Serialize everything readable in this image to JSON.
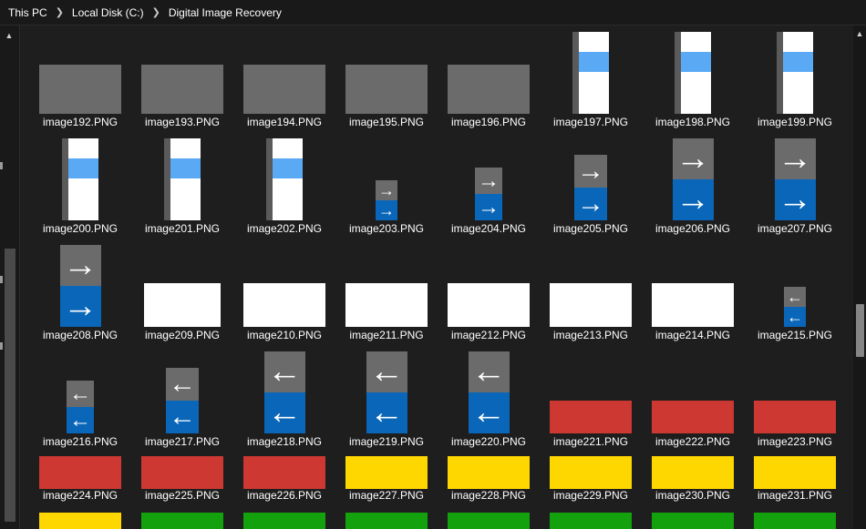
{
  "breadcrumb": [
    "This PC",
    "Local Disk (C:)",
    "Digital Image Recovery"
  ],
  "colors": {
    "gray": "#6b6b6b",
    "blue": "#0a66b8",
    "light_blue": "#5aa9f5",
    "red": "#cd3832",
    "yellow": "#ffd700",
    "green": "#13a10e"
  },
  "files": [
    {
      "name": "image192.PNG",
      "thumb": "gray"
    },
    {
      "name": "image193.PNG",
      "thumb": "gray"
    },
    {
      "name": "image194.PNG",
      "thumb": "gray"
    },
    {
      "name": "image195.PNG",
      "thumb": "gray"
    },
    {
      "name": "image196.PNG",
      "thumb": "gray"
    },
    {
      "name": "image197.PNG",
      "thumb": "scroll"
    },
    {
      "name": "image198.PNG",
      "thumb": "scroll"
    },
    {
      "name": "image199.PNG",
      "thumb": "scroll"
    },
    {
      "name": "image200.PNG",
      "thumb": "scroll"
    },
    {
      "name": "image201.PNG",
      "thumb": "scroll"
    },
    {
      "name": "image202.PNG",
      "thumb": "scroll"
    },
    {
      "name": "image203.PNG",
      "thumb": "arrow-right"
    },
    {
      "name": "image204.PNG",
      "thumb": "arrow-right"
    },
    {
      "name": "image205.PNG",
      "thumb": "arrow-right"
    },
    {
      "name": "image206.PNG",
      "thumb": "arrow-right"
    },
    {
      "name": "image207.PNG",
      "thumb": "arrow-right"
    },
    {
      "name": "image208.PNG",
      "thumb": "arrow-right"
    },
    {
      "name": "image209.PNG",
      "thumb": "white"
    },
    {
      "name": "image210.PNG",
      "thumb": "white"
    },
    {
      "name": "image211.PNG",
      "thumb": "white"
    },
    {
      "name": "image212.PNG",
      "thumb": "white"
    },
    {
      "name": "image213.PNG",
      "thumb": "white"
    },
    {
      "name": "image214.PNG",
      "thumb": "white"
    },
    {
      "name": "image215.PNG",
      "thumb": "arrow-left"
    },
    {
      "name": "image216.PNG",
      "thumb": "arrow-left"
    },
    {
      "name": "image217.PNG",
      "thumb": "arrow-left"
    },
    {
      "name": "image218.PNG",
      "thumb": "arrow-left"
    },
    {
      "name": "image219.PNG",
      "thumb": "arrow-left"
    },
    {
      "name": "image220.PNG",
      "thumb": "arrow-left"
    },
    {
      "name": "image221.PNG",
      "thumb": "red"
    },
    {
      "name": "image222.PNG",
      "thumb": "red"
    },
    {
      "name": "image223.PNG",
      "thumb": "red"
    },
    {
      "name": "image224.PNG",
      "thumb": "red"
    },
    {
      "name": "image225.PNG",
      "thumb": "red"
    },
    {
      "name": "image226.PNG",
      "thumb": "red"
    },
    {
      "name": "image227.PNG",
      "thumb": "yellow"
    },
    {
      "name": "image228.PNG",
      "thumb": "yellow"
    },
    {
      "name": "image229.PNG",
      "thumb": "yellow"
    },
    {
      "name": "image230.PNG",
      "thumb": "yellow"
    },
    {
      "name": "image231.PNG",
      "thumb": "yellow"
    },
    {
      "name": "",
      "thumb": "yellow"
    },
    {
      "name": "",
      "thumb": "green"
    },
    {
      "name": "",
      "thumb": "green"
    },
    {
      "name": "",
      "thumb": "green"
    },
    {
      "name": "",
      "thumb": "green"
    },
    {
      "name": "",
      "thumb": "green"
    },
    {
      "name": "",
      "thumb": "green"
    },
    {
      "name": "",
      "thumb": "green"
    }
  ]
}
